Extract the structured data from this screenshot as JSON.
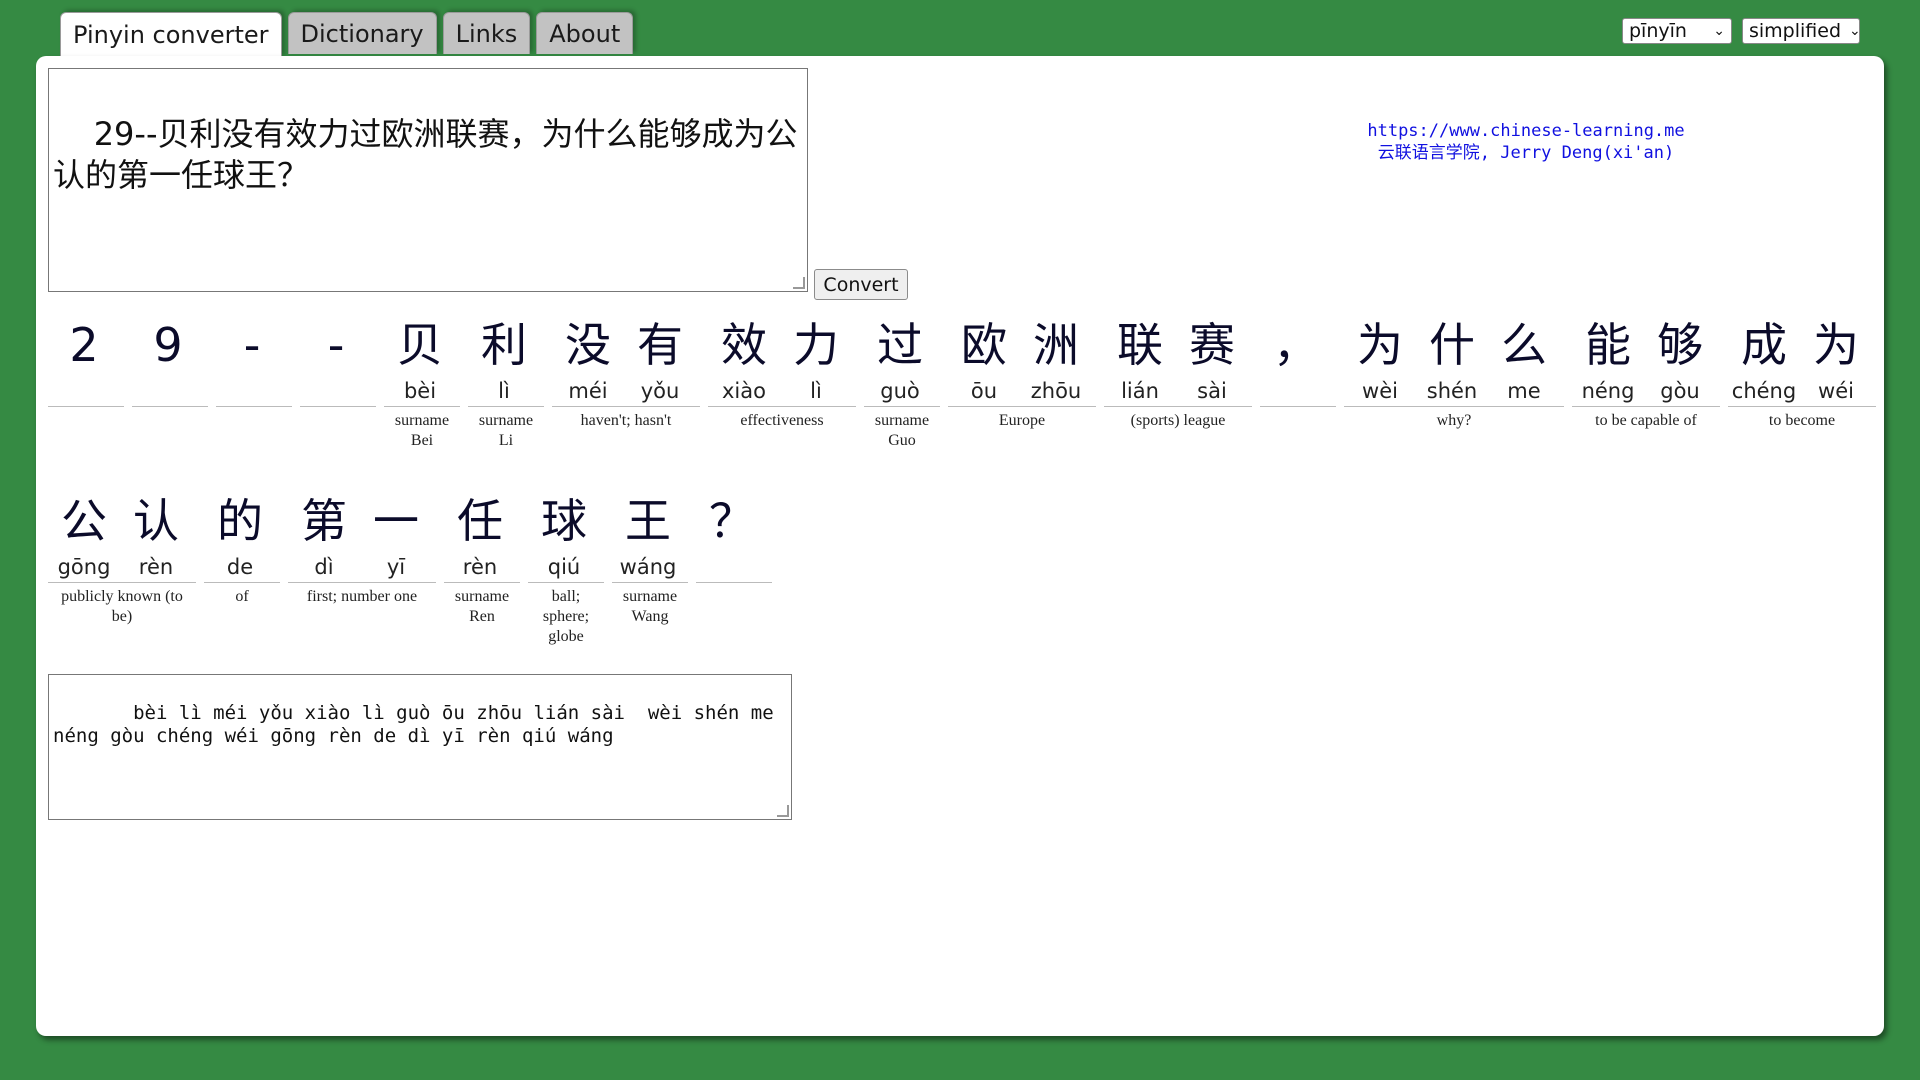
{
  "tabs": [
    {
      "label": "Pinyin converter",
      "active": true
    },
    {
      "label": "Dictionary",
      "active": false
    },
    {
      "label": "Links",
      "active": false
    },
    {
      "label": "About",
      "active": false
    }
  ],
  "selects": {
    "tone_mode": "pīnyīn",
    "script": "simplified"
  },
  "input": {
    "text": "29--贝利没有效力过欧洲联赛，为什么能够成为公认的第一任球王？"
  },
  "convert_button": "Convert",
  "credit": {
    "url": "https://www.chinese-learning.me",
    "author": "云联语言学院, Jerry Deng(xi'an)"
  },
  "rows": [
    [
      {
        "chars": [
          {
            "hz": "2",
            "py": ""
          }
        ],
        "def": ""
      },
      {
        "chars": [
          {
            "hz": "9",
            "py": ""
          }
        ],
        "def": ""
      },
      {
        "chars": [
          {
            "hz": "-",
            "py": ""
          }
        ],
        "def": ""
      },
      {
        "chars": [
          {
            "hz": "-",
            "py": ""
          }
        ],
        "def": ""
      },
      {
        "chars": [
          {
            "hz": "贝",
            "py": "bèi"
          }
        ],
        "def": "surname Bei"
      },
      {
        "chars": [
          {
            "hz": "利",
            "py": "lì"
          }
        ],
        "def": "surname Li"
      },
      {
        "chars": [
          {
            "hz": "没",
            "py": "méi"
          },
          {
            "hz": "有",
            "py": "yǒu"
          }
        ],
        "def": "haven't; hasn't"
      },
      {
        "chars": [
          {
            "hz": "效",
            "py": "xiào"
          },
          {
            "hz": "力",
            "py": "lì"
          }
        ],
        "def": "effectiveness"
      },
      {
        "chars": [
          {
            "hz": "过",
            "py": "guò"
          }
        ],
        "def": "surname Guo"
      },
      {
        "chars": [
          {
            "hz": "欧",
            "py": "ōu"
          },
          {
            "hz": "洲",
            "py": "zhōu"
          }
        ],
        "def": "Europe"
      },
      {
        "chars": [
          {
            "hz": "联",
            "py": "lián"
          },
          {
            "hz": "赛",
            "py": "sài"
          }
        ],
        "def": "(sports) league"
      },
      {
        "chars": [
          {
            "hz": "，",
            "py": ""
          }
        ],
        "def": ""
      },
      {
        "chars": [
          {
            "hz": "为",
            "py": "wèi"
          },
          {
            "hz": "什",
            "py": "shén"
          },
          {
            "hz": "么",
            "py": "me"
          }
        ],
        "def": "why?"
      },
      {
        "chars": [
          {
            "hz": "能",
            "py": "néng"
          },
          {
            "hz": "够",
            "py": "gòu"
          }
        ],
        "def": "to be capable of"
      },
      {
        "chars": [
          {
            "hz": "成",
            "py": "chéng"
          },
          {
            "hz": "为",
            "py": "wéi"
          }
        ],
        "def": "to become"
      }
    ],
    [
      {
        "chars": [
          {
            "hz": "公",
            "py": "gōng"
          },
          {
            "hz": "认",
            "py": "rèn"
          }
        ],
        "def": "publicly known (to be)"
      },
      {
        "chars": [
          {
            "hz": "的",
            "py": "de"
          }
        ],
        "def": "of"
      },
      {
        "chars": [
          {
            "hz": "第",
            "py": "dì"
          },
          {
            "hz": "一",
            "py": "yī"
          }
        ],
        "def": "first; number one"
      },
      {
        "chars": [
          {
            "hz": "任",
            "py": "rèn"
          }
        ],
        "def": "surname Ren"
      },
      {
        "chars": [
          {
            "hz": "球",
            "py": "qiú"
          }
        ],
        "def": "ball; sphere; globe"
      },
      {
        "chars": [
          {
            "hz": "王",
            "py": "wáng"
          }
        ],
        "def": "surname Wang"
      },
      {
        "chars": [
          {
            "hz": "？",
            "py": ""
          }
        ],
        "def": ""
      }
    ]
  ],
  "output": {
    "text": "   bèi lì méi yǒu xiào lì guò ōu zhōu lián sài  wèi shén me néng gòu chéng wéi gōng rèn de dì yī rèn qiú wáng"
  }
}
